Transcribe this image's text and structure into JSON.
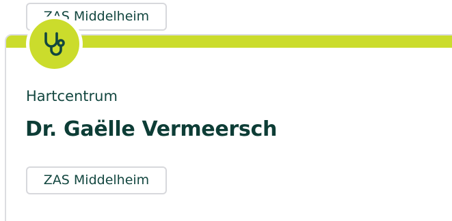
{
  "previous_card": {
    "location_label": "ZAS Middelheim"
  },
  "card": {
    "icon": "stethoscope-icon",
    "department": "Hartcentrum",
    "doctor_name": "Dr. Gaëlle Vermeersch",
    "location_label": "ZAS Middelheim"
  },
  "colors": {
    "accent": "#cbdc2c",
    "text_dark_green": "#0d3d36",
    "border_gray": "#d7d8dc"
  }
}
